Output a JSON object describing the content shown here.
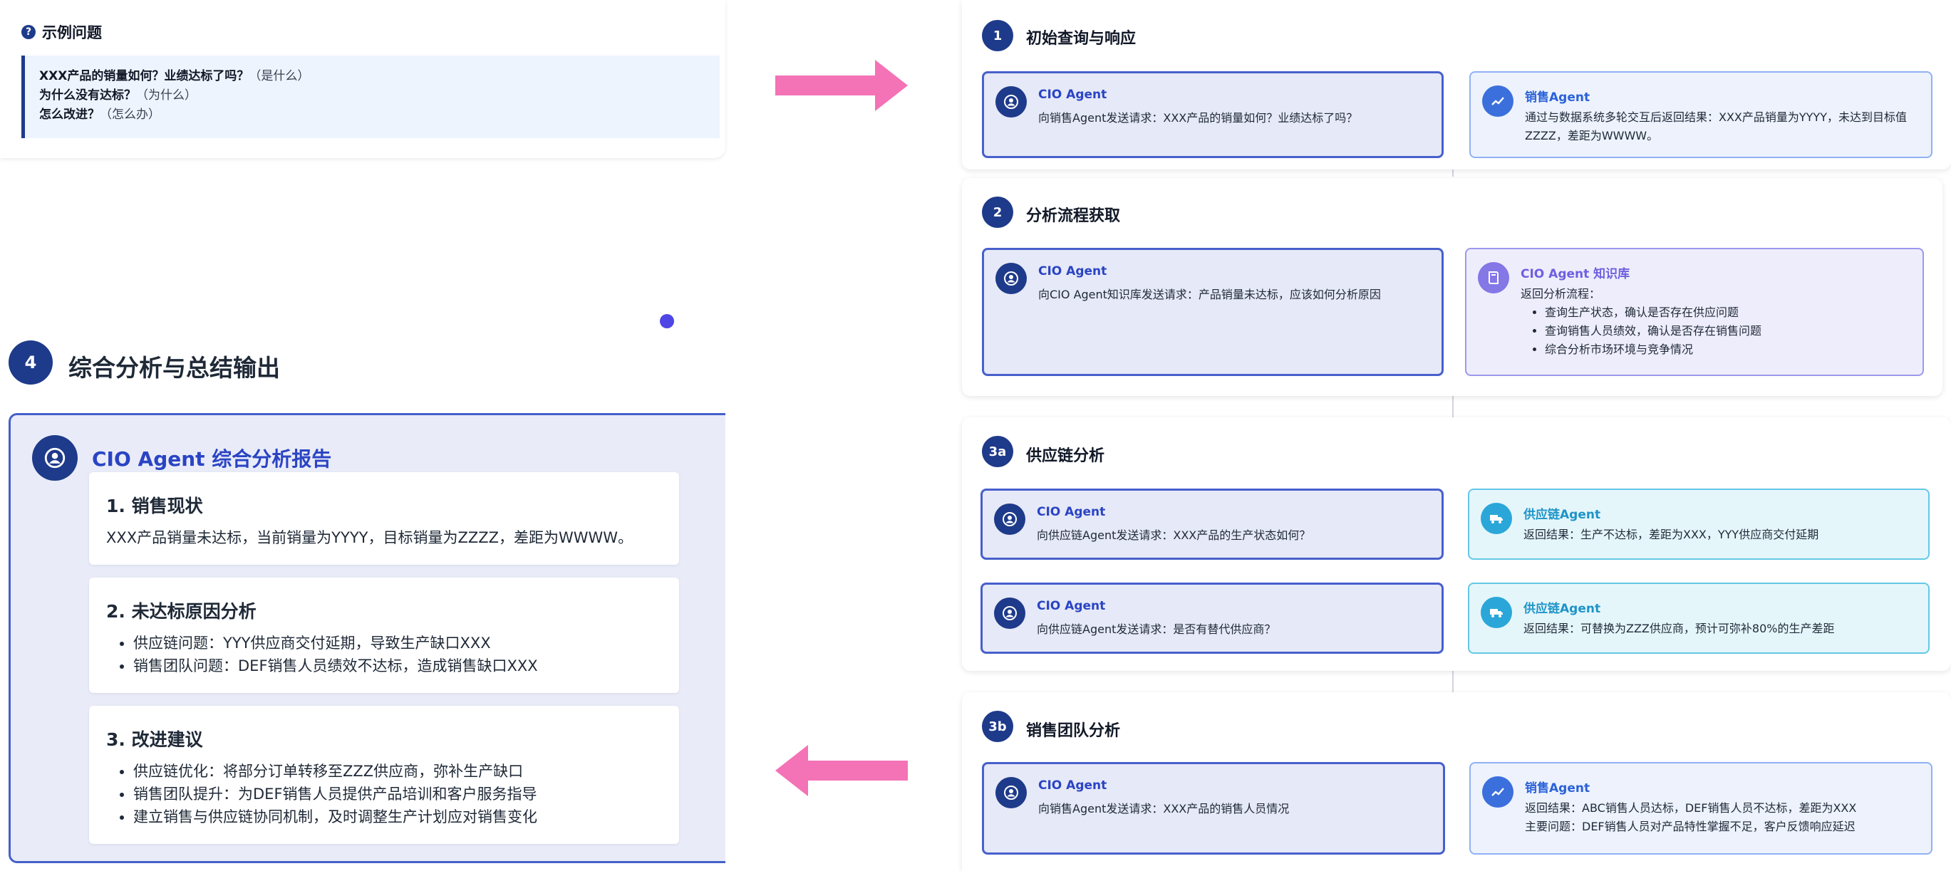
{
  "example": {
    "title": "示例问题",
    "lines": [
      {
        "q": "XXX产品的销量如何？业绩达标了吗？",
        "tag": "（是什么）"
      },
      {
        "q": "为什么没有达标？",
        "tag": "（为什么）"
      },
      {
        "q": "怎么改进？",
        "tag": "（怎么办）"
      }
    ]
  },
  "section4": {
    "num": "4",
    "title": "综合分析与总结输出",
    "report_title": "CIO Agent 综合分析报告",
    "blocks": [
      {
        "heading": "1. 销售现状",
        "text": "XXX产品销量未达标，当前销量为YYYY，目标销量为ZZZZ，差距为WWWW。"
      },
      {
        "heading": "2. 未达标原因分析",
        "items": [
          "供应链问题：YYY供应商交付延期，导致生产缺口XXX",
          "销售团队问题：DEF销售人员绩效不达标，造成销售缺口XXX"
        ]
      },
      {
        "heading": "3. 改进建议",
        "items": [
          "供应链优化：将部分订单转移至ZZZ供应商，弥补生产缺口",
          "销售团队提升：为DEF销售人员提供产品培训和客户服务指导",
          "建立销售与供应链协同机制，及时调整生产计划应对销售变化"
        ]
      }
    ]
  },
  "steps": [
    {
      "num": "1",
      "title": "初始查询与响应",
      "left": {
        "title": "CIO Agent",
        "text": "向销售Agent发送请求：XXX产品的销量如何？业绩达标了吗？"
      },
      "right": {
        "title": "销售Agent",
        "text": "通过与数据系统多轮交互后返回结果：XXX产品销量为YYYY，未达到目标值ZZZZ，差距为WWWW。"
      }
    },
    {
      "num": "2",
      "title": "分析流程获取",
      "left": {
        "title": "CIO Agent",
        "text": "向CIO Agent知识库发送请求：产品销量未达标，应该如何分析原因"
      },
      "right": {
        "title": "CIO Agent 知识库",
        "text": "返回分析流程：",
        "items": [
          "查询生产状态，确认是否存在供应问题",
          "查询销售人员绩效，确认是否存在销售问题",
          "综合分析市场环境与竞争情况"
        ]
      }
    },
    {
      "num": "3a",
      "title": "供应链分析",
      "rows": [
        {
          "left": {
            "title": "CIO Agent",
            "text": "向供应链Agent发送请求：XXX产品的生产状态如何？"
          },
          "right": {
            "title": "供应链Agent",
            "text": "返回结果：生产不达标，差距为XXX，YYY供应商交付延期"
          }
        },
        {
          "left": {
            "title": "CIO Agent",
            "text": "向供应链Agent发送请求：是否有替代供应商？"
          },
          "right": {
            "title": "供应链Agent",
            "text": "返回结果：可替换为ZZZ供应商，预计可弥补80%的生产差距"
          }
        }
      ]
    },
    {
      "num": "3b",
      "title": "销售团队分析",
      "left": {
        "title": "CIO Agent",
        "text": "向销售Agent发送请求：XXX产品的销售人员情况"
      },
      "right": {
        "title": "销售Agent",
        "text": "返回结果：ABC销售人员达标，DEF销售人员不达标，差距为XXX",
        "text2": "主要问题：DEF销售人员对产品特性掌握不足，客户反馈响应延迟"
      }
    }
  ],
  "colors": {
    "arrow": "#f472b6",
    "primary": "#1e3a8a",
    "accent": "#4f46e5"
  }
}
